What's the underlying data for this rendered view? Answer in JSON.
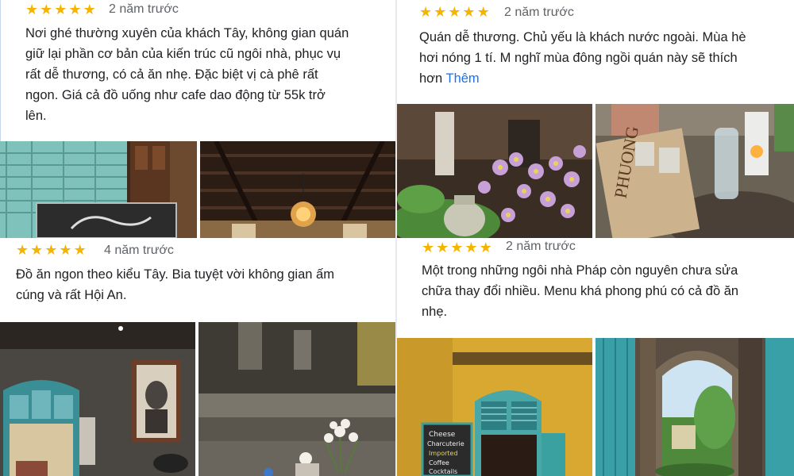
{
  "colors": {
    "star": "#f5b400",
    "link": "#1a73e8",
    "text": "#202124",
    "meta": "#5f6368"
  },
  "reviews": [
    {
      "rating": 5,
      "time": "2 năm trước",
      "lines": [
        "Nơi ghé thường xuyên của khách Tây, không gian quán",
        "giữ lại phần cơ bản của kiến trúc cũ ngôi nhà, phục vụ",
        "rất dễ thương, có cả ăn nhẹ. Đặc biệt vị cà phê rất",
        "ngon. Giá cả đồ uống như cafe dao động từ 55k trở",
        "lên."
      ],
      "photos": [
        "Teal wooden shutters with chalkboard sign",
        "Dark wooden ceiling with rattan pendant lamp"
      ]
    },
    {
      "rating": 5,
      "time": "2 năm trước",
      "lines": [
        "Quán dễ thương. Chủ yếu là khách nước ngoài. Mùa hè",
        "hơi nóng 1 tí. M nghĩ mùa đông ngồi quán này sẽ thích",
        "hơn"
      ],
      "more": "Thêm",
      "photos": [
        "Purple daisies and ceramic lantern on table",
        "Coffee bags, glasses and lantern on table"
      ]
    },
    {
      "rating": 5,
      "time": "4 năm trước",
      "lines": [
        "Đồ ăn ngon theo kiểu Tây. Bia tuyệt vời không gian ấm",
        "cúng và rất Hội An."
      ],
      "photos": [
        "Teal arched door with framed portrait on dark wall",
        "White flowers in vase with blurred street"
      ]
    },
    {
      "rating": 5,
      "time": "2 năm trước",
      "lines": [
        "Một trong những ngôi nhà Pháp còn nguyên chưa sửa",
        "chữa thay đổi nhiều. Menu khá phong phú có cả đồ ăn",
        "nhẹ."
      ],
      "photos": [
        "Yellow wall with teal window and chalkboard menu",
        "Stone archway opening to green garden"
      ],
      "chalkboard": [
        "Cheese",
        "Charcuterie",
        "Imported",
        "Coffee",
        "Cocktails"
      ]
    }
  ]
}
